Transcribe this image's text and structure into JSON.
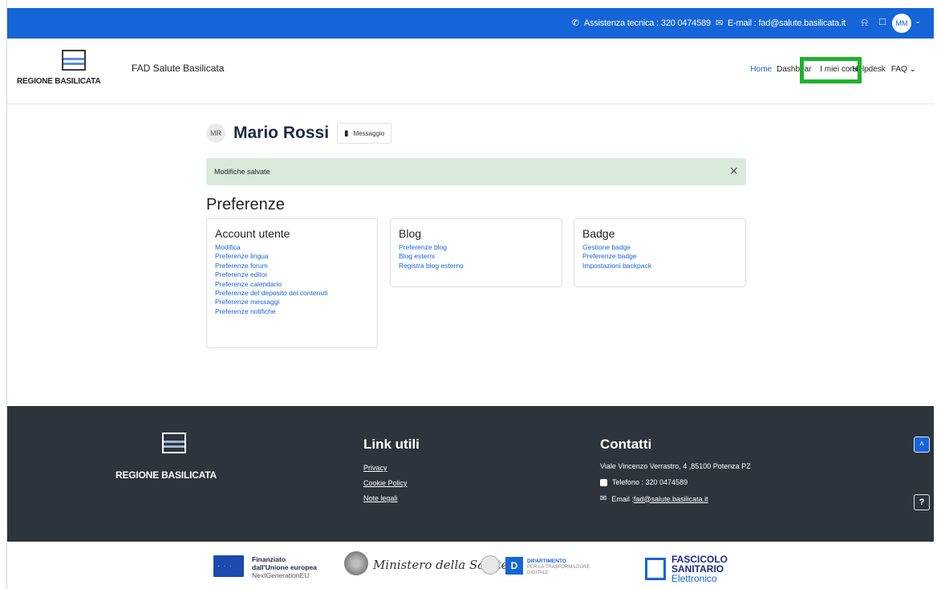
{
  "topbar": {
    "support_label": "Assistenza tecnica : 320 0474589",
    "email_label": "E-mail : fad@salute.basilicata.it",
    "avatar_initials": "MM",
    "background_color": "#1565d8"
  },
  "header": {
    "logo_text": "REGIONE BASILICATA",
    "site_name": "FAD Salute Basilicata",
    "nav": {
      "home": "Home",
      "dashboard": "Dashboard",
      "my_courses": "I miei corsi",
      "helpdesk": "Helpdesk",
      "faq": "FAQ"
    },
    "highlight_color": "#1db32c"
  },
  "profile": {
    "initials": "MR",
    "name": "Mario Rossi",
    "message_button": "Messaggio"
  },
  "alert": {
    "text": "Modifiche salvate",
    "close_icon": "×"
  },
  "preferences": {
    "title": "Preferenze",
    "cards": [
      {
        "title": "Account utente",
        "links": [
          "Modifica",
          "Preferenze lingua",
          "Preferenze forum",
          "Preferenze editor",
          "Preferenze calendario",
          "Preferenze del deposito dei contenuti",
          "Preferenze messaggi",
          "Preferenze notifiche"
        ]
      },
      {
        "title": "Blog",
        "links": [
          "Preferenze blog",
          "Blog esterni",
          "Registra blog esterno"
        ]
      },
      {
        "title": "Badge",
        "links": [
          "Gestione badge",
          "Preferenze badge",
          "Impostazioni backpack"
        ]
      }
    ]
  },
  "footer": {
    "logo_text": "REGIONE BASILICATA",
    "links_title": "Link utili",
    "links": [
      "Privacy",
      "Cookie Policy",
      "Note legali"
    ],
    "contacts_title": "Contatti",
    "address": "Viale Vincenzo Verrastro, 4 ,85100 Potenza PZ",
    "phone": "Telefono : 320 0474589",
    "email_prefix": "Email : ",
    "email": "fad@salute.basilicata.it",
    "background_color": "#2d343b"
  },
  "partners": {
    "eu_line1": "Finanziato",
    "eu_line2": "dall'Unione europea",
    "eu_line3": "NextGenerationEU",
    "ministero": "Ministero della Salute",
    "dip_line1": "DIPARTIMENTO",
    "dip_line2": "PER LA TRASFORMAZIONE",
    "dip_line3": "DIGITALE",
    "dip_letter": "D",
    "fse_line1": "FASCICOLO",
    "fse_line2": "SANITARIO",
    "fse_line3": "Elettronico"
  }
}
